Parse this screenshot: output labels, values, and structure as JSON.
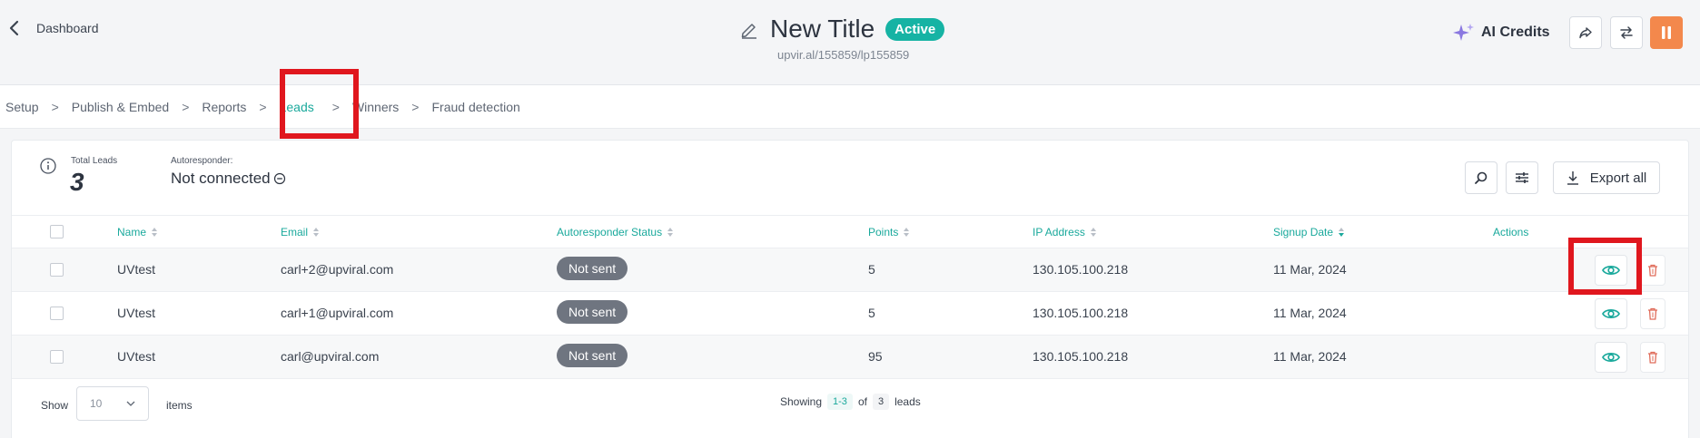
{
  "header": {
    "back_label": "Dashboard",
    "title": "New Title",
    "status_badge": "Active",
    "subtitle": "upvir.al/155859/lp155859",
    "ai_credits_label": "AI Credits",
    "icons": [
      "chevron-left-icon",
      "pencil-icon",
      "sparkle-icon",
      "share-icon",
      "swap-icon",
      "pause-icon"
    ]
  },
  "breadcrumbs": [
    {
      "label": "Setup",
      "active": false
    },
    {
      "label": "Publish & Embed",
      "active": false
    },
    {
      "label": "Reports",
      "active": false
    },
    {
      "label": "Leads",
      "active": true
    },
    {
      "label": "Winners",
      "active": false
    },
    {
      "label": "Fraud detection",
      "active": false
    }
  ],
  "stats": {
    "total_leads_label": "Total Leads",
    "total_leads_value": "3",
    "autoresponder_label": "Autoresponder:",
    "autoresponder_value": "Not connected",
    "export_label": "Export all"
  },
  "table": {
    "columns": [
      "Name",
      "Email",
      "Autoresponder Status",
      "Points",
      "IP Address",
      "Signup Date",
      "Actions"
    ],
    "sorted_column": "Signup Date",
    "rows": [
      {
        "name": "UVtest",
        "email": "carl+2@upviral.com",
        "status": "Not sent",
        "points": "5",
        "ip": "130.105.100.218",
        "date": "11 Mar, 2024"
      },
      {
        "name": "UVtest",
        "email": "carl+1@upviral.com",
        "status": "Not sent",
        "points": "5",
        "ip": "130.105.100.218",
        "date": "11 Mar, 2024"
      },
      {
        "name": "UVtest",
        "email": "carl@upviral.com",
        "status": "Not sent",
        "points": "95",
        "ip": "130.105.100.218",
        "date": "11 Mar, 2024"
      }
    ]
  },
  "footer": {
    "show_label": "Show",
    "page_size": "10",
    "items_label": "items",
    "showing_label": "Showing",
    "range": "1-3",
    "of_label": "of",
    "total": "3",
    "leads_label": "leads"
  },
  "colors": {
    "accent": "#1aa99c",
    "orange": "#f3884c",
    "danger": "#e06c5a",
    "highlight": "#e0171e"
  }
}
